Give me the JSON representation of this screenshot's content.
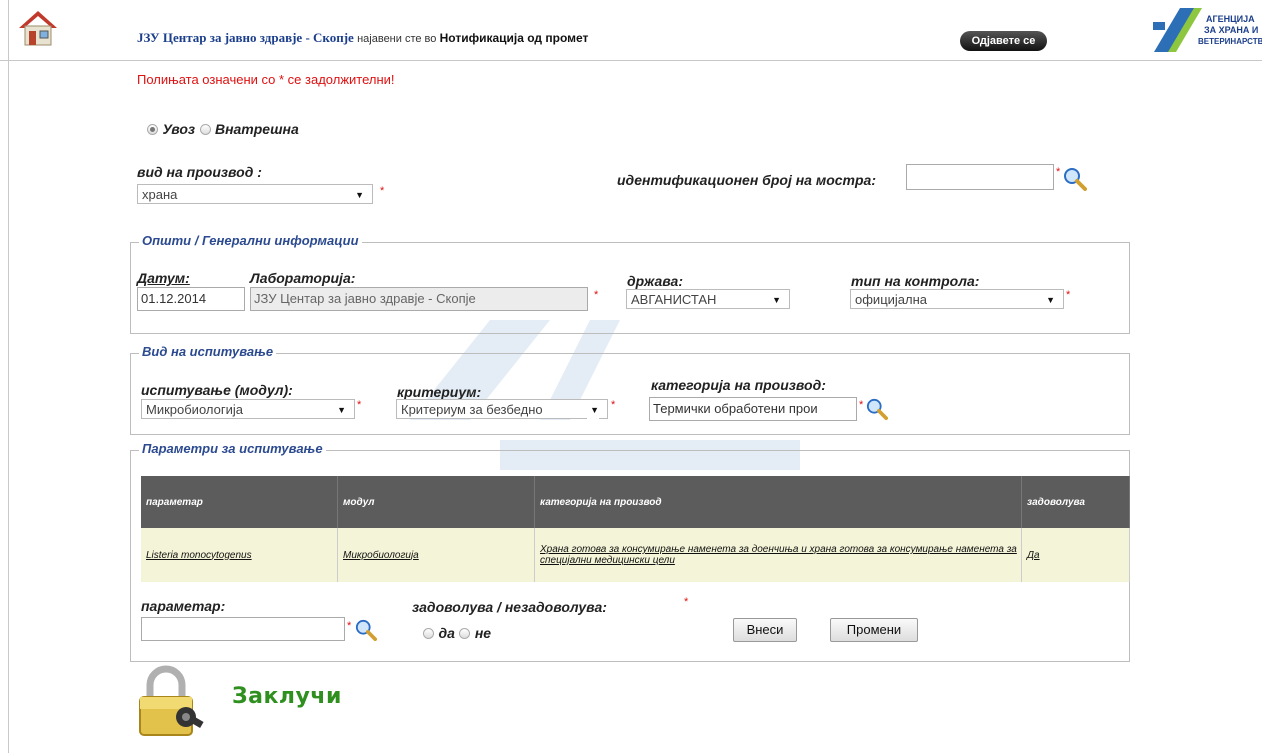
{
  "header": {
    "org": "ЈЗУ Центар за јавно здравје - Скопје",
    "logged_in_text": "најавени сте во",
    "page": "Нотификација од промет",
    "logout_label": "Одјавете се",
    "agency_logo_lines": [
      "АГЕНЦИЈА",
      "ЗА ХРАНА И",
      "ВЕТЕРИНАРСТВО"
    ]
  },
  "required_note": "Полињата означени со * се задолжителни!",
  "import_type": {
    "options": [
      "Увоз",
      "Внатрешна"
    ],
    "selected": "Увоз"
  },
  "product_type": {
    "label": "вид на производ :",
    "value": "храна"
  },
  "sample_id": {
    "label": "идентификационен број на мостра:",
    "value": ""
  },
  "general_info": {
    "legend": "Општи / Генерални информации",
    "date_label": "Датум:",
    "date_value": "01.12.2014",
    "lab_label": "Лабораторија:",
    "lab_value": "ЈЗУ Центар за јавно здравје - Скопје",
    "country_label": "држава:",
    "country_value": "АВГАНИСТАН",
    "control_label": "тип на контрола:",
    "control_value": "официјална"
  },
  "test_type": {
    "legend": "Вид на испитување",
    "module_label": "испитување (модул):",
    "module_value": "Микробиологија",
    "criterion_label": "критериум:",
    "criterion_value": "Критериум за безбедно",
    "category_label": "категорија на производ:",
    "category_value": "Термички обработени прои"
  },
  "params": {
    "legend": "Параметри за испитување",
    "columns": [
      "параметар",
      "модул",
      "категорија на производ",
      "задоволува"
    ],
    "rows": [
      {
        "param": "Listeria monocytogenus",
        "module": "Микробиологија",
        "category": "Храна готова за консумирање наменета за доенчиња и храна готова за консумирање наменета за специјални медицински цели",
        "satisfies": "Да"
      }
    ],
    "param_label": "параметар:",
    "param_value": "",
    "satisfies_label": "задоволува / незадоволува:",
    "satisfies_options": [
      "да",
      "не"
    ],
    "insert_label": "Внеси",
    "change_label": "Промени"
  },
  "lock": {
    "label": "Заклучи"
  },
  "colors": {
    "accent": "#1c3f8c",
    "required": "#e01010",
    "lock_green": "#2f8f1f"
  }
}
